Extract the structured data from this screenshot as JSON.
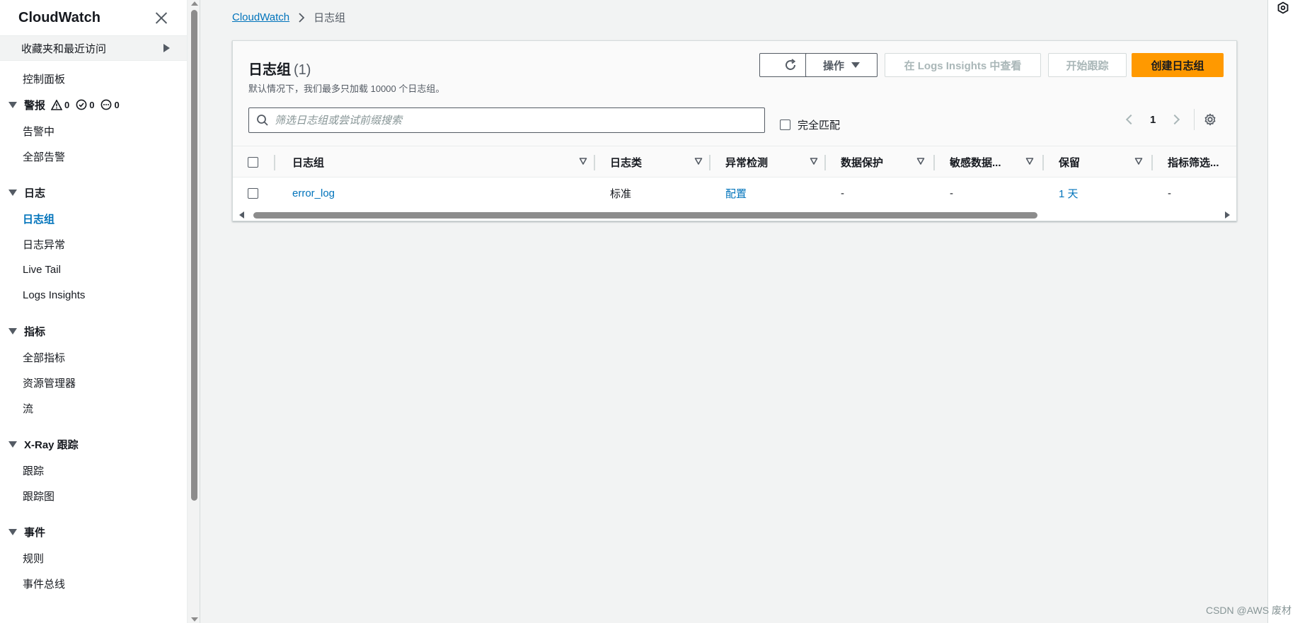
{
  "sidebar": {
    "title": "CloudWatch",
    "favorites_label": "收藏夹和最近访问",
    "dashboard": "控制面板",
    "alarms": {
      "label": "警报",
      "badge_alarm": "0",
      "badge_ok": "0",
      "badge_insufficient": "0",
      "items": [
        "告警中",
        "全部告警"
      ]
    },
    "logs": {
      "label": "日志",
      "items": [
        "日志组",
        "日志异常",
        "Live Tail",
        "Logs Insights"
      ]
    },
    "metrics": {
      "label": "指标",
      "items": [
        "全部指标",
        "资源管理器",
        "流"
      ]
    },
    "xray": {
      "label": "X-Ray 跟踪",
      "items": [
        "跟踪",
        "跟踪图"
      ]
    },
    "events": {
      "label": "事件",
      "items": [
        "规则",
        "事件总线"
      ]
    }
  },
  "breadcrumb": {
    "root": "CloudWatch",
    "current": "日志组"
  },
  "panel": {
    "title": "日志组",
    "count": "(1)",
    "description": "默认情况下，我们最多只加载 10000 个日志组。",
    "buttons": {
      "actions": "操作",
      "view_insights": "在 Logs Insights 中查看",
      "start_tailing": "开始跟踪",
      "create": "创建日志组"
    },
    "search_placeholder": "筛选日志组或尝试前缀搜索",
    "exact_match": "完全匹配",
    "page": "1"
  },
  "table": {
    "columns": [
      "日志组",
      "日志类",
      "异常检测",
      "数据保护",
      "敏感数据...",
      "保留",
      "指标筛选..."
    ],
    "rows": [
      {
        "log_group": "error_log",
        "log_class": "标准",
        "anomaly": "配置",
        "data_protection": "-",
        "sensitive": "-",
        "retention": "1 天",
        "metric_filters": "-"
      }
    ]
  },
  "watermark": "CSDN @AWS 废材",
  "colors": {
    "accent_link": "#0073bb",
    "primary_button": "#ff9900",
    "background": "#f2f3f3"
  }
}
